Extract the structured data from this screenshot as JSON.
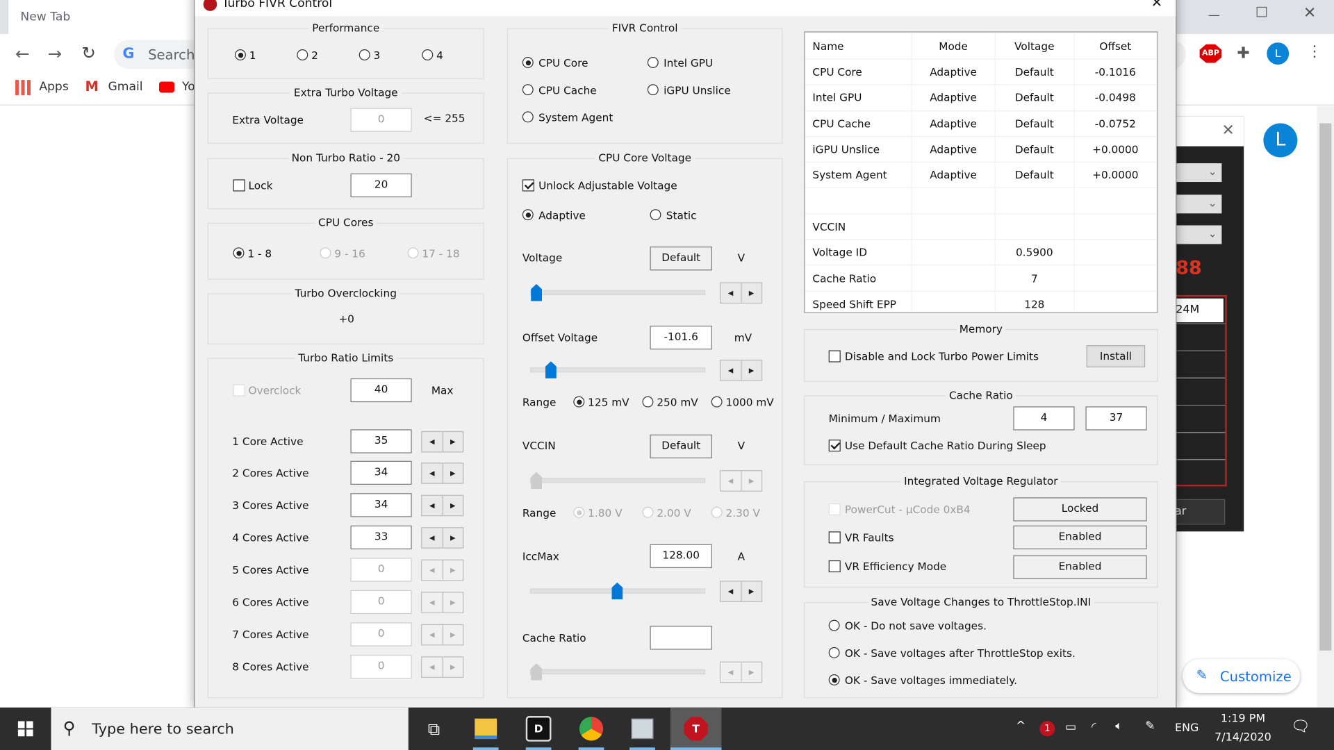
{
  "browser": {
    "tab_title": "New Tab",
    "omnibox_placeholder": "Search",
    "bookmarks": [
      {
        "label": "Apps",
        "icon": "apps-grid-icon"
      },
      {
        "label": "Gmail",
        "icon": "gmail-icon"
      },
      {
        "label": "Yo",
        "icon": "youtube-icon"
      }
    ],
    "extensions": [
      "ABP",
      "puzzle-icon"
    ],
    "profile_initial": "L",
    "customize_label": "Customize",
    "background_app": {
      "digits": "88",
      "field_value": "24M",
      "button_fragment": "ar"
    }
  },
  "dialog": {
    "title": "Turbo FIVR Control",
    "performance": {
      "title": "Performance",
      "options": [
        "1",
        "2",
        "3",
        "4"
      ],
      "selected": "1"
    },
    "extra_turbo": {
      "title": "Extra Turbo Voltage",
      "label": "Extra Voltage",
      "value": "0",
      "limit": "<= 255"
    },
    "non_turbo": {
      "title": "Non Turbo Ratio - 20",
      "lock_label": "Lock",
      "lock_checked": false,
      "value": "20"
    },
    "cpu_cores": {
      "title": "CPU Cores",
      "options": [
        "1 - 8",
        "9 - 16",
        "17 - 18"
      ],
      "selected": "1 - 8"
    },
    "turbo_oc": {
      "title": "Turbo Overclocking",
      "value": "+0"
    },
    "turbo_ratio": {
      "title": "Turbo Ratio Limits",
      "overclock_label": "Overclock",
      "max_value": "40",
      "max_label": "Max",
      "rows": [
        {
          "label": "1 Core Active",
          "value": "35",
          "enabled": true
        },
        {
          "label": "2 Cores Active",
          "value": "34",
          "enabled": true
        },
        {
          "label": "3 Cores Active",
          "value": "34",
          "enabled": true
        },
        {
          "label": "4 Cores Active",
          "value": "33",
          "enabled": true
        },
        {
          "label": "5 Cores Active",
          "value": "0",
          "enabled": false
        },
        {
          "label": "6 Cores Active",
          "value": "0",
          "enabled": false
        },
        {
          "label": "7 Cores Active",
          "value": "0",
          "enabled": false
        },
        {
          "label": "8 Cores Active",
          "value": "0",
          "enabled": false
        }
      ]
    },
    "fivr": {
      "title": "FIVR Control",
      "options": [
        "CPU Core",
        "Intel GPU",
        "CPU Cache",
        "iGPU Unslice",
        "System Agent"
      ],
      "selected": "CPU Core"
    },
    "core_voltage": {
      "title": "CPU Core Voltage",
      "unlock_label": "Unlock Adjustable Voltage",
      "unlock_checked": true,
      "mode_adaptive": "Adaptive",
      "mode_static": "Static",
      "mode_selected": "Adaptive",
      "voltage_label": "Voltage",
      "voltage_value": "Default",
      "voltage_unit": "V",
      "voltage_slider": 0,
      "offset_label": "Offset Voltage",
      "offset_value": "-101.6",
      "offset_unit": "mV",
      "offset_slider": 0.09,
      "range_label": "Range",
      "offset_ranges": [
        "125 mV",
        "250 mV",
        "1000 mV"
      ],
      "offset_range_selected": "125 mV",
      "vccin_label": "VCCIN",
      "vccin_value": "Default",
      "vccin_unit": "V",
      "vccin_slider": 0,
      "vccin_ranges": [
        "1.80 V",
        "2.00 V",
        "2.30 V"
      ],
      "vccin_range_selected": "1.80 V",
      "iccmax_label": "IccMax",
      "iccmax_value": "128.00",
      "iccmax_unit": "A",
      "iccmax_slider": 0.5,
      "cache_label": "Cache Ratio",
      "cache_value": "",
      "cache_slider": 0
    },
    "table": {
      "headers": [
        "Name",
        "Mode",
        "Voltage",
        "Offset"
      ],
      "rows": [
        [
          "CPU Core",
          "Adaptive",
          "Default",
          "-0.1016"
        ],
        [
          "Intel GPU",
          "Adaptive",
          "Default",
          "-0.0498"
        ],
        [
          "CPU Cache",
          "Adaptive",
          "Default",
          "-0.0752"
        ],
        [
          "iGPU Unslice",
          "Adaptive",
          "Default",
          "+0.0000"
        ],
        [
          "System Agent",
          "Adaptive",
          "Default",
          "+0.0000"
        ],
        [
          "",
          "",
          "",
          ""
        ],
        [
          "VCCIN",
          "",
          "",
          ""
        ],
        [
          "Voltage ID",
          "",
          "0.5900",
          ""
        ],
        [
          "Cache Ratio",
          "",
          "7",
          ""
        ],
        [
          "Speed Shift EPP",
          "",
          "128",
          ""
        ]
      ]
    },
    "memory": {
      "title": "Memory",
      "label": "Disable and Lock Turbo Power Limits",
      "checked": false,
      "install": "Install"
    },
    "cache_ratio": {
      "title": "Cache Ratio",
      "label": "Minimum / Maximum",
      "min": "4",
      "max": "37",
      "sleep_label": "Use Default Cache Ratio During Sleep",
      "sleep_checked": true
    },
    "ivr": {
      "title": "Integrated Voltage Regulator",
      "powercut_label": "PowerCut  -  µCode 0xB4",
      "powercut_state": "Locked",
      "vrfaults_label": "VR Faults",
      "vrfaults_state": "Enabled",
      "vreff_label": "VR Efficiency Mode",
      "vreff_state": "Enabled"
    },
    "save": {
      "title": "Save Voltage Changes to ThrottleStop.INI",
      "options": [
        "OK - Do not save voltages.",
        "OK - Save voltages after ThrottleStop exits.",
        "OK - Save voltages immediately."
      ],
      "selected": 2
    }
  },
  "taskbar": {
    "search_placeholder": "Type here to search",
    "apps": [
      "task-view-icon",
      "file-explorer-icon",
      "d-app-icon",
      "chrome-icon",
      "monitor-app-icon",
      "throttlestop-icon"
    ],
    "tray_language": "ENG",
    "time": "1:19 PM",
    "date": "7/14/2020",
    "notification_badge": "1"
  }
}
